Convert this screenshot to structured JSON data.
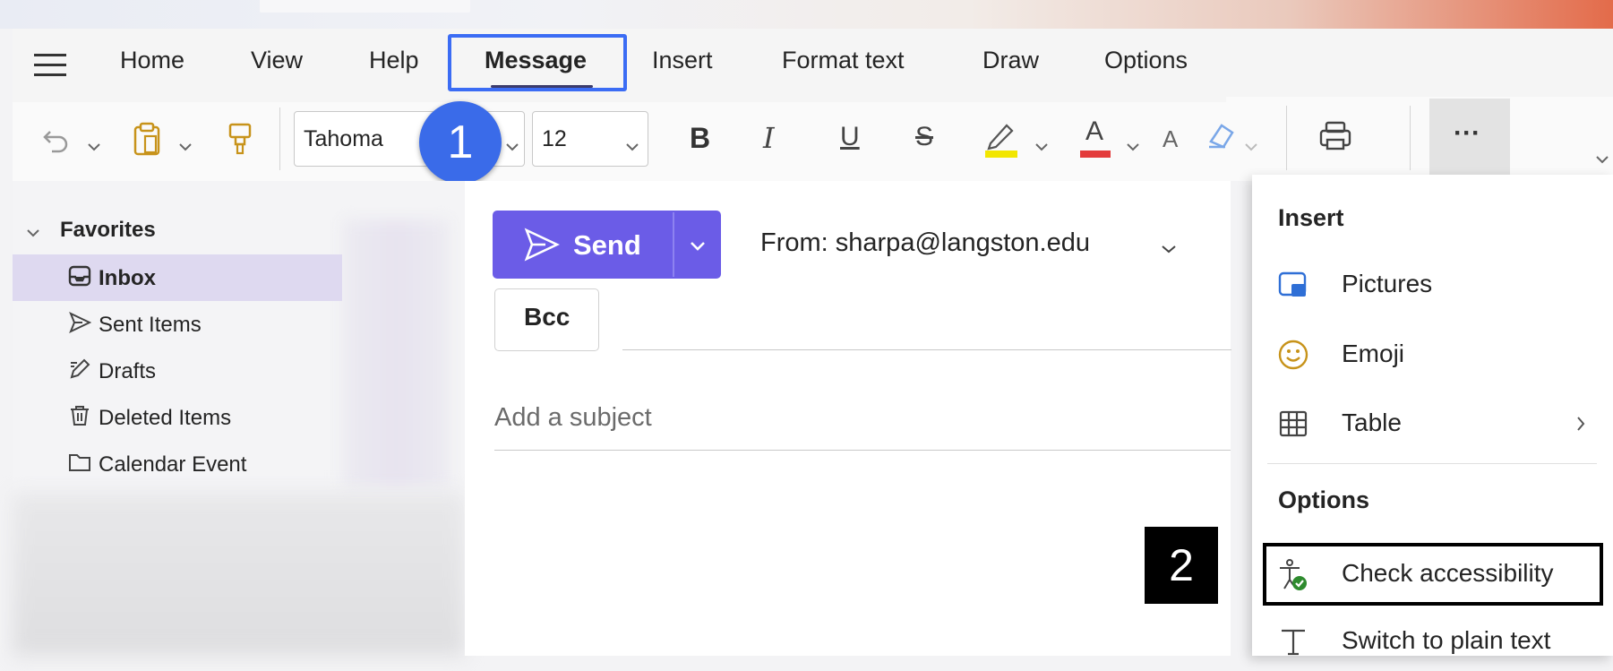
{
  "ribbon": {
    "tabs": [
      {
        "label": "Home"
      },
      {
        "label": "View"
      },
      {
        "label": "Help"
      },
      {
        "label": "Message"
      },
      {
        "label": "Insert"
      },
      {
        "label": "Format text"
      },
      {
        "label": "Draw"
      },
      {
        "label": "Options"
      }
    ],
    "active_tab": "Message"
  },
  "toolbar": {
    "font_name": "Tahoma",
    "font_size": "12",
    "bold_glyph": "B",
    "italic_glyph": "I",
    "underline_glyph": "U",
    "strike_glyph": "S",
    "font_color_glyph": "A",
    "grow_font_glyph": "A",
    "more_glyph": "···",
    "highlight_color": "#f2e600",
    "font_color": "#e33b3b"
  },
  "annotations": {
    "step1": "1",
    "step2": "2"
  },
  "sidebar": {
    "section_label": "Favorites",
    "items": [
      {
        "label": "Inbox",
        "icon": "inbox-icon",
        "selected": true
      },
      {
        "label": "Sent Items",
        "icon": "send-icon"
      },
      {
        "label": "Drafts",
        "icon": "pencil-icon"
      },
      {
        "label": "Deleted Items",
        "icon": "trash-icon"
      },
      {
        "label": "Calendar Event",
        "icon": "folder-icon"
      }
    ]
  },
  "compose": {
    "send_label": "Send",
    "from_label": "From: sharpa@langston.edu",
    "bcc_label": "Bcc",
    "subject_placeholder": "Add a subject",
    "accent": "#6b5ce7"
  },
  "menu": {
    "insert_heading": "Insert",
    "insert_items": [
      {
        "label": "Pictures",
        "icon": "picture-icon"
      },
      {
        "label": "Emoji",
        "icon": "emoji-icon"
      },
      {
        "label": "Table",
        "icon": "table-icon"
      }
    ],
    "options_heading": "Options",
    "options_items": [
      {
        "label": "Check accessibility",
        "icon": "accessibility-icon"
      },
      {
        "label": "Switch to plain text",
        "icon": "text-icon"
      }
    ]
  }
}
